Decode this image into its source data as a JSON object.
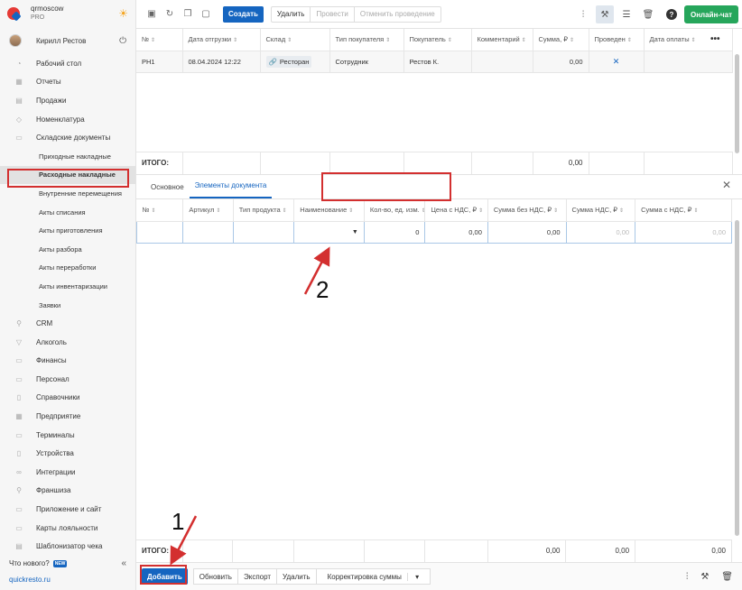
{
  "brand": {
    "name": "qrmoscow",
    "plan": "PRO"
  },
  "user": {
    "name": "Кирилл Рестов"
  },
  "sidebar": {
    "items": [
      {
        "label": "Рабочий стол",
        "icon": "dashboard-icon",
        "glyph": "◔"
      },
      {
        "label": "Отчеты",
        "icon": "reports-icon",
        "glyph": "▦"
      },
      {
        "label": "Продажи",
        "icon": "sales-icon",
        "glyph": "▤"
      },
      {
        "label": "Номенклатура",
        "icon": "tag-icon",
        "glyph": "◇"
      },
      {
        "label": "Складские документы",
        "icon": "warehouse-icon",
        "glyph": "▭"
      }
    ],
    "subitems": [
      "Приходные накладные",
      "Расходные накладные",
      "Внутренние перемещения",
      "Акты списания",
      "Акты приготовления",
      "Акты разбора",
      "Акты переработки",
      "Акты инвентаризации",
      "Заявки"
    ],
    "items2": [
      {
        "label": "CRM",
        "icon": "crm-icon",
        "glyph": "⚲"
      },
      {
        "label": "Алкоголь",
        "icon": "alcohol-icon",
        "glyph": "▽"
      },
      {
        "label": "Финансы",
        "icon": "finance-icon",
        "glyph": "▭"
      },
      {
        "label": "Персонал",
        "icon": "staff-icon",
        "glyph": "▭"
      },
      {
        "label": "Справочники",
        "icon": "book-icon",
        "glyph": "▯"
      },
      {
        "label": "Предприятие",
        "icon": "enterprise-icon",
        "glyph": "▦"
      },
      {
        "label": "Терминалы",
        "icon": "terminal-icon",
        "glyph": "▭"
      },
      {
        "label": "Устройства",
        "icon": "devices-icon",
        "glyph": "▯"
      },
      {
        "label": "Интеграции",
        "icon": "integrations-icon",
        "glyph": "∞"
      },
      {
        "label": "Франшиза",
        "icon": "franchise-icon",
        "glyph": "⚲"
      },
      {
        "label": "Приложение и сайт",
        "icon": "app-icon",
        "glyph": "▭"
      },
      {
        "label": "Карты лояльности",
        "icon": "loyalty-card-icon",
        "glyph": "▭"
      },
      {
        "label": "Шаблонизатор чека",
        "icon": "receipt-template-icon",
        "glyph": "▤"
      }
    ],
    "whats_new": "Что нового?",
    "new_badge": "NEW",
    "site_link": "quickresto.ru"
  },
  "toolbar": {
    "create": "Создать",
    "delete": "Удалить",
    "post": "Провести",
    "unpost": "Отменить проведение",
    "online_chat": "Онлайн-чат"
  },
  "doc_table": {
    "headers": [
      "№",
      "Дата отгрузки",
      "Склад",
      "Тип покупателя",
      "Покупатель",
      "Комментарий",
      "Сумма, ₽",
      "Проведен",
      "Дата оплаты"
    ],
    "row": {
      "number": "РН1",
      "date": "08.04.2024 12:22",
      "warehouse": "Ресторан",
      "buyer_type": "Сотрудник",
      "buyer": "Рестов К.",
      "comment": "",
      "sum": "0,00",
      "posted": "✕",
      "pay_date": ""
    },
    "total_label": "ИТОГО:",
    "total_sum": "0,00"
  },
  "tabs": [
    {
      "label": "Основное"
    },
    {
      "label": "Элементы документа"
    }
  ],
  "elements_table": {
    "headers": [
      "№",
      "Артикул",
      "Тип продукта",
      "Наименование",
      "Кол-во, ед. изм.",
      "Цена с НДС, ₽",
      "Сумма без НДС, ₽",
      "Сумма НДС, ₽",
      "Сумма с НДС, ₽"
    ],
    "row": {
      "qty": "0",
      "price": "0,00",
      "sum_no_vat": "0,00",
      "vat": "0,00",
      "sum_vat": "0,00"
    },
    "total_label": "ИТОГО:",
    "totals": {
      "sum_no_vat": "0,00",
      "vat": "0,00",
      "sum_vat": "0,00"
    }
  },
  "bottom": {
    "add": "Добавить",
    "refresh": "Обновить",
    "export": "Экспорт",
    "delete": "Удалить",
    "correction": "Корректировка суммы"
  },
  "annotations": {
    "one": "1",
    "two": "2"
  },
  "colors": {
    "accent": "#1565c0",
    "green": "#26a65b",
    "highlight": "#d32f2f"
  }
}
